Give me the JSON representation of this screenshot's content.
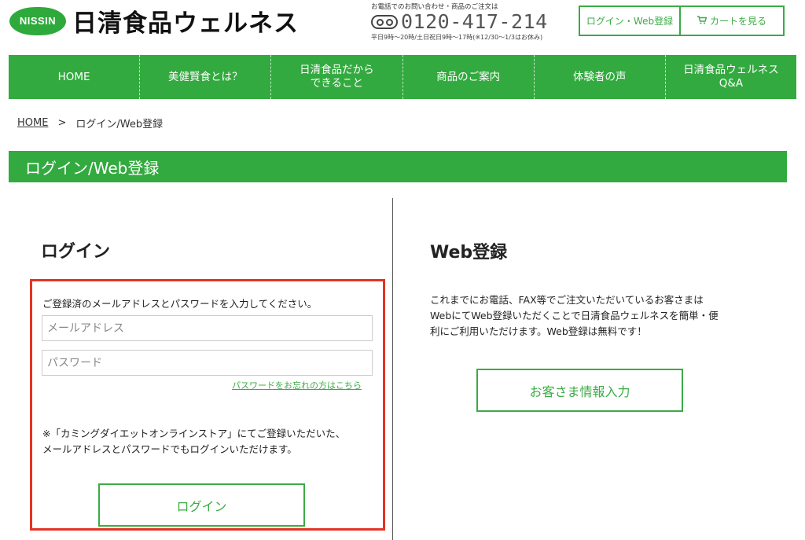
{
  "header": {
    "logo_badge": "NISSIN",
    "brand_name": "日清食品ウェルネス",
    "phone_note": "お電話でのお問い合わせ・商品のご注文は",
    "phone_number": "0120-417-214",
    "phone_hours": "平日9時〜20時/土日祝日9時〜17時(※12/30〜1/3はお休み)",
    "login_button": "ログイン・Web登録",
    "cart_button": "カートを見る",
    "cart_icon": "cart-icon",
    "freedial_icon": "freedial-icon"
  },
  "nav": {
    "items": [
      {
        "label": "HOME"
      },
      {
        "label": "美健賢食とは？"
      },
      {
        "label": "日清食品だから\nできること"
      },
      {
        "label": "商品のご案内"
      },
      {
        "label": "体験者の声"
      },
      {
        "label": "日清食品ウェルネス\nQ&A"
      }
    ]
  },
  "breadcrumb": {
    "home": "HOME",
    "separator": ">",
    "current": "ログイン/Web登録"
  },
  "page_title": "ログイン/Web登録",
  "login": {
    "heading": "ログイン",
    "lead": "ご登録済のメールアドレスとパスワードを入力してください。",
    "email_placeholder": "メールアドレス",
    "password_placeholder": "パスワード",
    "forgot_link": "パスワードをお忘れの方はこちら",
    "note": "※「カミングダイエットオンラインストア」にてご登録いただいた、\nメールアドレスとパスワードでもログインいただけます。",
    "button": "ログイン"
  },
  "web_register": {
    "heading": "Web登録",
    "description": "これまでにお電話、FAX等でご注文いただいているお客さまは\nWebにてWeb登録いただくことで日清食品ウェルネスを簡単・便\n利にご利用いただけます。Web登録は無料です！",
    "button": "お客さま情報入力"
  },
  "colors": {
    "brand_green": "#33aa3f",
    "highlight_red": "#e53323"
  }
}
